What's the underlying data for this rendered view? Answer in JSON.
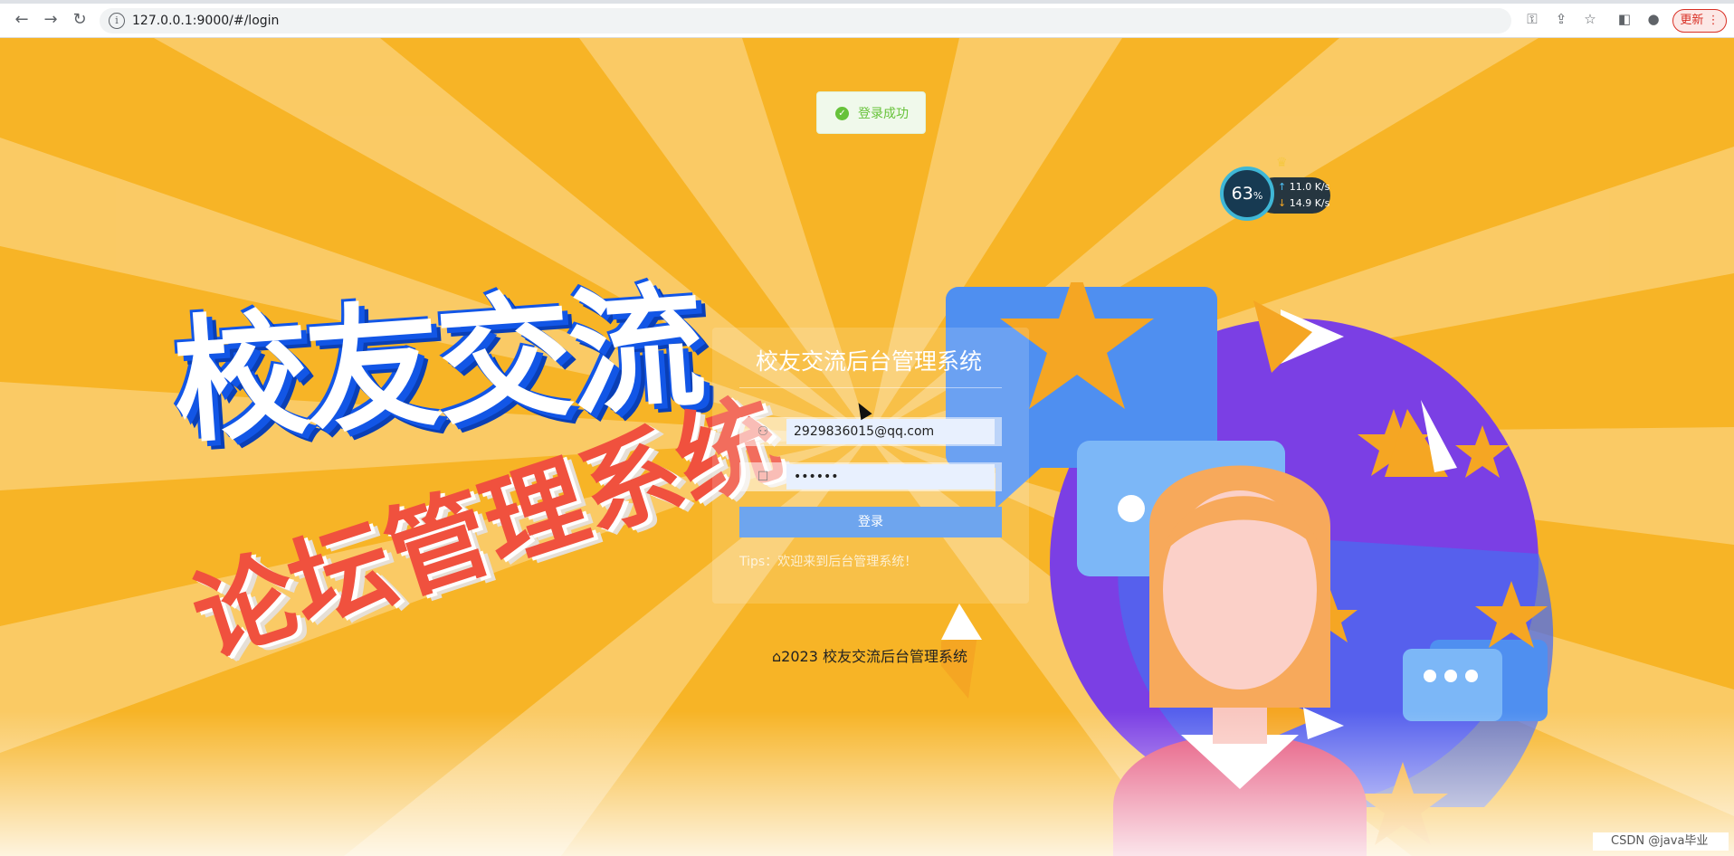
{
  "browser": {
    "url": "127.0.0.1:9000/#/login",
    "update_label": "更新",
    "info_icon": "info-icon",
    "icons": [
      "back-icon",
      "forward-icon",
      "reload-icon",
      "key-icon",
      "share-icon",
      "bookmark-star-icon",
      "side-panel-icon",
      "profile-icon",
      "menu-dots-icon"
    ]
  },
  "toast": {
    "message": "登录成功",
    "color": "#67c23a"
  },
  "banner": {
    "title": "校友交流",
    "subtitle": "论坛管理系统"
  },
  "login": {
    "title": "校友交流后台管理系统",
    "username_value": "2929836015@qq.com",
    "password_value": "••••••",
    "submit_label": "登录",
    "tips": "Tips：欢迎来到后台管理系统！"
  },
  "footer": {
    "copyright": "2023 校友交流后台管理系统"
  },
  "speed_widget": {
    "percent": "63",
    "percent_unit": "%",
    "upload": "11.0 K/s",
    "download": "14.9 K/s"
  },
  "watermark": "CSDN @java毕业",
  "colors": {
    "background": "#f7b426",
    "title_blue": "#1256e6",
    "subtitle_red": "#f0513e",
    "button_blue": "#6ea5ee"
  }
}
